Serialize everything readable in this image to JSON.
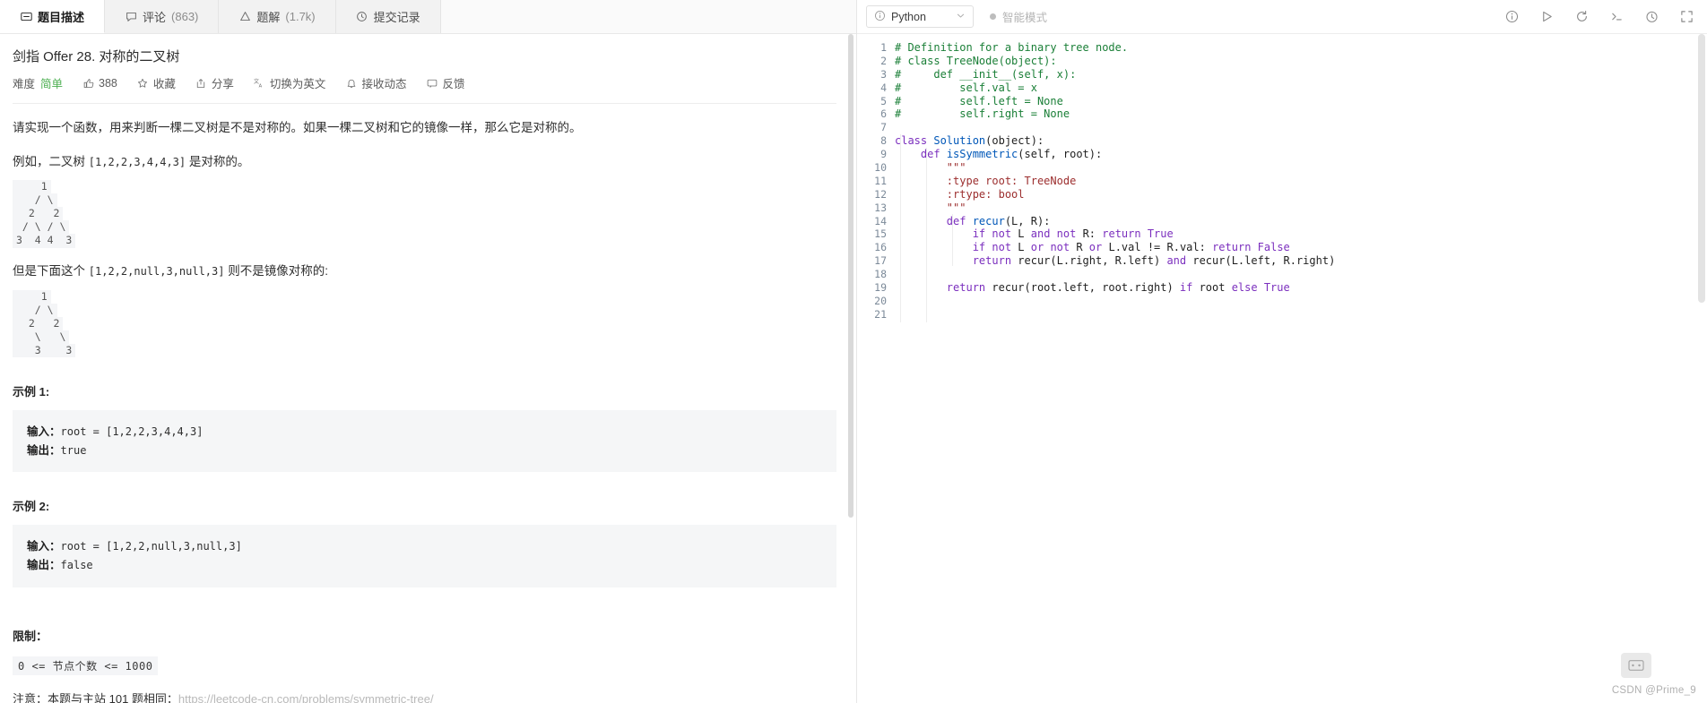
{
  "tabs": [
    {
      "label": "题目描述",
      "icon": "description-icon",
      "count": "",
      "active": true
    },
    {
      "label": "评论",
      "icon": "comment-icon",
      "count": "(863)",
      "active": false
    },
    {
      "label": "题解",
      "icon": "solution-icon",
      "count": "(1.7k)",
      "active": false
    },
    {
      "label": "提交记录",
      "icon": "history-icon",
      "count": "",
      "active": false
    }
  ],
  "problem": {
    "title": "剑指 Offer 28. 对称的二叉树",
    "difficulty_label": "难度",
    "difficulty_value": "简单",
    "difficulty_color": "#4caf50",
    "likes": "388",
    "actions": [
      {
        "label": "收藏",
        "icon": "star-icon"
      },
      {
        "label": "分享",
        "icon": "share-icon"
      },
      {
        "label": "切换为英文",
        "icon": "translate-icon"
      },
      {
        "label": "接收动态",
        "icon": "bell-icon"
      },
      {
        "label": "反馈",
        "icon": "feedback-icon"
      }
    ],
    "paragraph1": "请实现一个函数，用来判断一棵二叉树是不是对称的。如果一棵二叉树和它的镜像一样，那么它是对称的。",
    "paragraph2_pre": "例如，二叉树 ",
    "paragraph2_code": "[1,2,2,3,4,4,3]",
    "paragraph2_post": " 是对称的。",
    "tree1": [
      "    1",
      "   / \\",
      "  2   2",
      " / \\ / \\",
      "3  4 4  3"
    ],
    "paragraph3_pre": "但是下面这个 ",
    "paragraph3_code": "[1,2,2,null,3,null,3]",
    "paragraph3_post": " 则不是镜像对称的:",
    "tree2": [
      "    1",
      "   / \\",
      "  2   2",
      "   \\   \\",
      "   3    3"
    ],
    "example1_title": "示例 1:",
    "example1_input_label": "输入：",
    "example1_input_value": "root = [1,2,2,3,4,4,3]",
    "example1_output_label": "输出：",
    "example1_output_value": "true",
    "example2_title": "示例 2:",
    "example2_input_label": "输入：",
    "example2_input_value": "root = [1,2,2,null,3,null,3]",
    "example2_output_label": "输出：",
    "example2_output_value": "false",
    "limit_title": "限制：",
    "limit_value": "0 <= 节点个数 <= 1000",
    "note_prefix": "注意：本题与主站 101 题相同：",
    "note_link": "https://leetcode-cn.com/problems/symmetric-tree/"
  },
  "editor": {
    "language": "Python",
    "language_icon": "info-icon",
    "dropdown_icon": "chevron-down-icon",
    "smart_mode_label": "智能模式",
    "toolbar_icons": [
      "info-icon",
      "run-icon",
      "reset-icon",
      "console-icon",
      "timer-icon",
      "fullscreen-icon"
    ],
    "line_count": 21,
    "lines": [
      {
        "n": 1,
        "tokens": [
          {
            "t": "# Definition for a binary tree node.",
            "c": "cm"
          }
        ]
      },
      {
        "n": 2,
        "tokens": [
          {
            "t": "# class TreeNode(object):",
            "c": "cm"
          }
        ]
      },
      {
        "n": 3,
        "tokens": [
          {
            "t": "#     def __init__(self, x):",
            "c": "cm"
          }
        ]
      },
      {
        "n": 4,
        "tokens": [
          {
            "t": "#         self.val = x",
            "c": "cm"
          }
        ]
      },
      {
        "n": 5,
        "tokens": [
          {
            "t": "#         self.left = None",
            "c": "cm"
          }
        ]
      },
      {
        "n": 6,
        "tokens": [
          {
            "t": "#         self.right = None",
            "c": "cm"
          }
        ]
      },
      {
        "n": 7,
        "tokens": []
      },
      {
        "n": 8,
        "tokens": [
          {
            "t": "class ",
            "c": "k"
          },
          {
            "t": "Solution",
            "c": "kb"
          },
          {
            "t": "(object):",
            "c": "fn"
          }
        ]
      },
      {
        "n": 9,
        "tokens": [
          {
            "t": "    ",
            "c": "fn"
          },
          {
            "t": "def ",
            "c": "k"
          },
          {
            "t": "isSymmetric",
            "c": "kb"
          },
          {
            "t": "(self, root):",
            "c": "fn"
          }
        ]
      },
      {
        "n": 10,
        "tokens": [
          {
            "t": "        \"\"\"",
            "c": "st"
          }
        ]
      },
      {
        "n": 11,
        "tokens": [
          {
            "t": "        :type root: TreeNode",
            "c": "st"
          }
        ]
      },
      {
        "n": 12,
        "tokens": [
          {
            "t": "        :rtype: bool",
            "c": "st"
          }
        ]
      },
      {
        "n": 13,
        "tokens": [
          {
            "t": "        \"\"\"",
            "c": "st"
          }
        ]
      },
      {
        "n": 14,
        "tokens": [
          {
            "t": "        ",
            "c": "fn"
          },
          {
            "t": "def ",
            "c": "k"
          },
          {
            "t": "recur",
            "c": "kb"
          },
          {
            "t": "(L, R):",
            "c": "fn"
          }
        ]
      },
      {
        "n": 15,
        "tokens": [
          {
            "t": "            ",
            "c": "fn"
          },
          {
            "t": "if ",
            "c": "k"
          },
          {
            "t": "not ",
            "c": "k"
          },
          {
            "t": "L ",
            "c": "fn"
          },
          {
            "t": "and ",
            "c": "k"
          },
          {
            "t": "not ",
            "c": "k"
          },
          {
            "t": "R: ",
            "c": "fn"
          },
          {
            "t": "return ",
            "c": "k"
          },
          {
            "t": "True",
            "c": "k"
          }
        ]
      },
      {
        "n": 16,
        "tokens": [
          {
            "t": "            ",
            "c": "fn"
          },
          {
            "t": "if ",
            "c": "k"
          },
          {
            "t": "not ",
            "c": "k"
          },
          {
            "t": "L ",
            "c": "fn"
          },
          {
            "t": "or ",
            "c": "k"
          },
          {
            "t": "not ",
            "c": "k"
          },
          {
            "t": "R ",
            "c": "fn"
          },
          {
            "t": "or ",
            "c": "k"
          },
          {
            "t": "L.val != R.val: ",
            "c": "fn"
          },
          {
            "t": "return ",
            "c": "k"
          },
          {
            "t": "False",
            "c": "k"
          }
        ]
      },
      {
        "n": 17,
        "tokens": [
          {
            "t": "            ",
            "c": "fn"
          },
          {
            "t": "return ",
            "c": "k"
          },
          {
            "t": "recur(L.right, R.left) ",
            "c": "fn"
          },
          {
            "t": "and ",
            "c": "k"
          },
          {
            "t": "recur(L.left, R.right)",
            "c": "fn"
          }
        ]
      },
      {
        "n": 18,
        "tokens": []
      },
      {
        "n": 19,
        "tokens": [
          {
            "t": "        ",
            "c": "fn"
          },
          {
            "t": "return ",
            "c": "k"
          },
          {
            "t": "recur(root.left, root.right) ",
            "c": "fn"
          },
          {
            "t": "if ",
            "c": "k"
          },
          {
            "t": "root ",
            "c": "fn"
          },
          {
            "t": "else ",
            "c": "k"
          },
          {
            "t": "True",
            "c": "k"
          }
        ]
      },
      {
        "n": 20,
        "tokens": []
      },
      {
        "n": 21,
        "tokens": []
      }
    ]
  },
  "watermark": "CSDN @Prime_9"
}
